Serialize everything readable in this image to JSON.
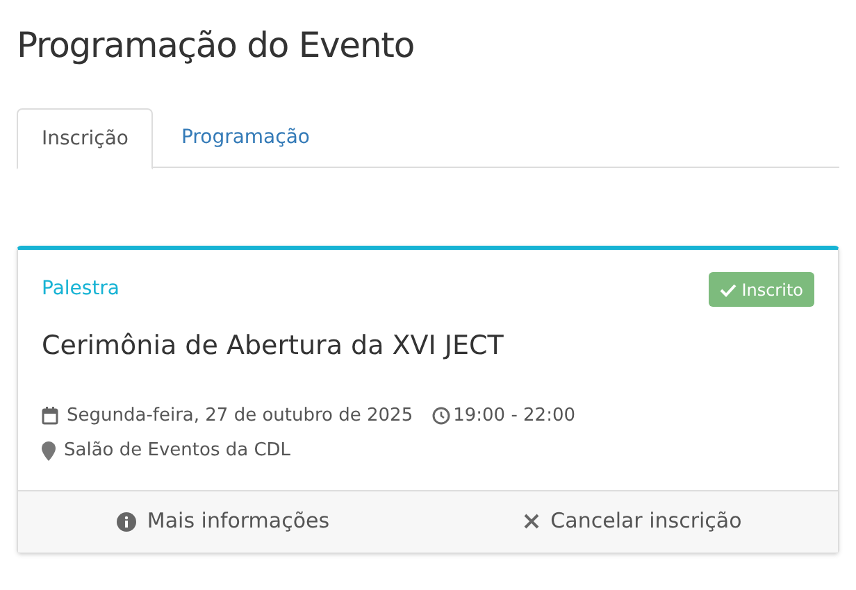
{
  "page_title": "Programação do Evento",
  "tabs": [
    {
      "label": "Inscrição",
      "selected": true
    },
    {
      "label": "Programação",
      "selected": false
    }
  ],
  "event": {
    "category": "Palestra",
    "status": {
      "label": "Inscrito",
      "registered": true
    },
    "title": "Cerimônia de Abertura da XVI JECT",
    "date": "Segunda-feira, 27 de outubro de 2025",
    "time": "19:00 - 22:00",
    "location": "Salão de Eventos da CDL",
    "actions": [
      {
        "kind": "info",
        "label": "Mais informações"
      },
      {
        "kind": "cancel",
        "label": "Cancelar inscrição"
      }
    ]
  }
}
